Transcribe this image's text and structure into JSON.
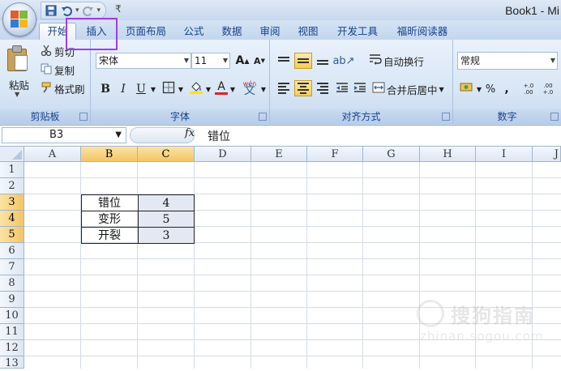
{
  "window": {
    "title": "Book1 - Mi"
  },
  "quick_access": {
    "save_icon": "save-icon",
    "undo_icon": "undo-icon",
    "redo_icon": "redo-icon",
    "more_symbol": "₹"
  },
  "tabs": [
    {
      "label": "开始",
      "active": true
    },
    {
      "label": "插入",
      "highlighted": true
    },
    {
      "label": "页面布局"
    },
    {
      "label": "公式"
    },
    {
      "label": "数据"
    },
    {
      "label": "审阅"
    },
    {
      "label": "视图"
    },
    {
      "label": "开发工具"
    },
    {
      "label": "福昕阅读器"
    }
  ],
  "highlight_color": "#a23be8",
  "ribbon": {
    "clipboard": {
      "paste": "粘贴",
      "cut": "剪切",
      "copy": "复制",
      "format_painter": "格式刷",
      "label": "剪贴板"
    },
    "font": {
      "name": "宋体",
      "size": "11",
      "grow": "A",
      "shrink": "A",
      "bold": "B",
      "italic": "I",
      "underline": "U",
      "font_color_letter": "A",
      "phonetic": "wén",
      "label": "字体"
    },
    "alignment": {
      "wrap_text": "自动换行",
      "merge_center": "合并后居中",
      "label": "对齐方式"
    },
    "number": {
      "format": "常规",
      "percent": "%",
      "comma": ",",
      "inc_decimal": "+.0 .00",
      "dec_decimal": ".00 +.0",
      "label": "数字"
    }
  },
  "formula_bar": {
    "name_box": "B3",
    "fx": "fx",
    "content": "错位"
  },
  "sheet": {
    "columns": [
      "A",
      "B",
      "C",
      "D",
      "E",
      "F",
      "G",
      "H",
      "I",
      "J"
    ],
    "selected_columns": [
      "B",
      "C"
    ],
    "rows": [
      "1",
      "2",
      "3",
      "4",
      "5",
      "6",
      "7",
      "8",
      "9",
      "10",
      "11",
      "12",
      "13"
    ],
    "selected_rows": [
      "3",
      "4",
      "5"
    ],
    "table": [
      {
        "row": "3",
        "label": "错位",
        "value": "4"
      },
      {
        "row": "4",
        "label": "变形",
        "value": "5"
      },
      {
        "row": "5",
        "label": "开裂",
        "value": "3"
      }
    ]
  },
  "watermark": {
    "text": "搜狗指南",
    "url": "zhinan.sogou.com"
  }
}
